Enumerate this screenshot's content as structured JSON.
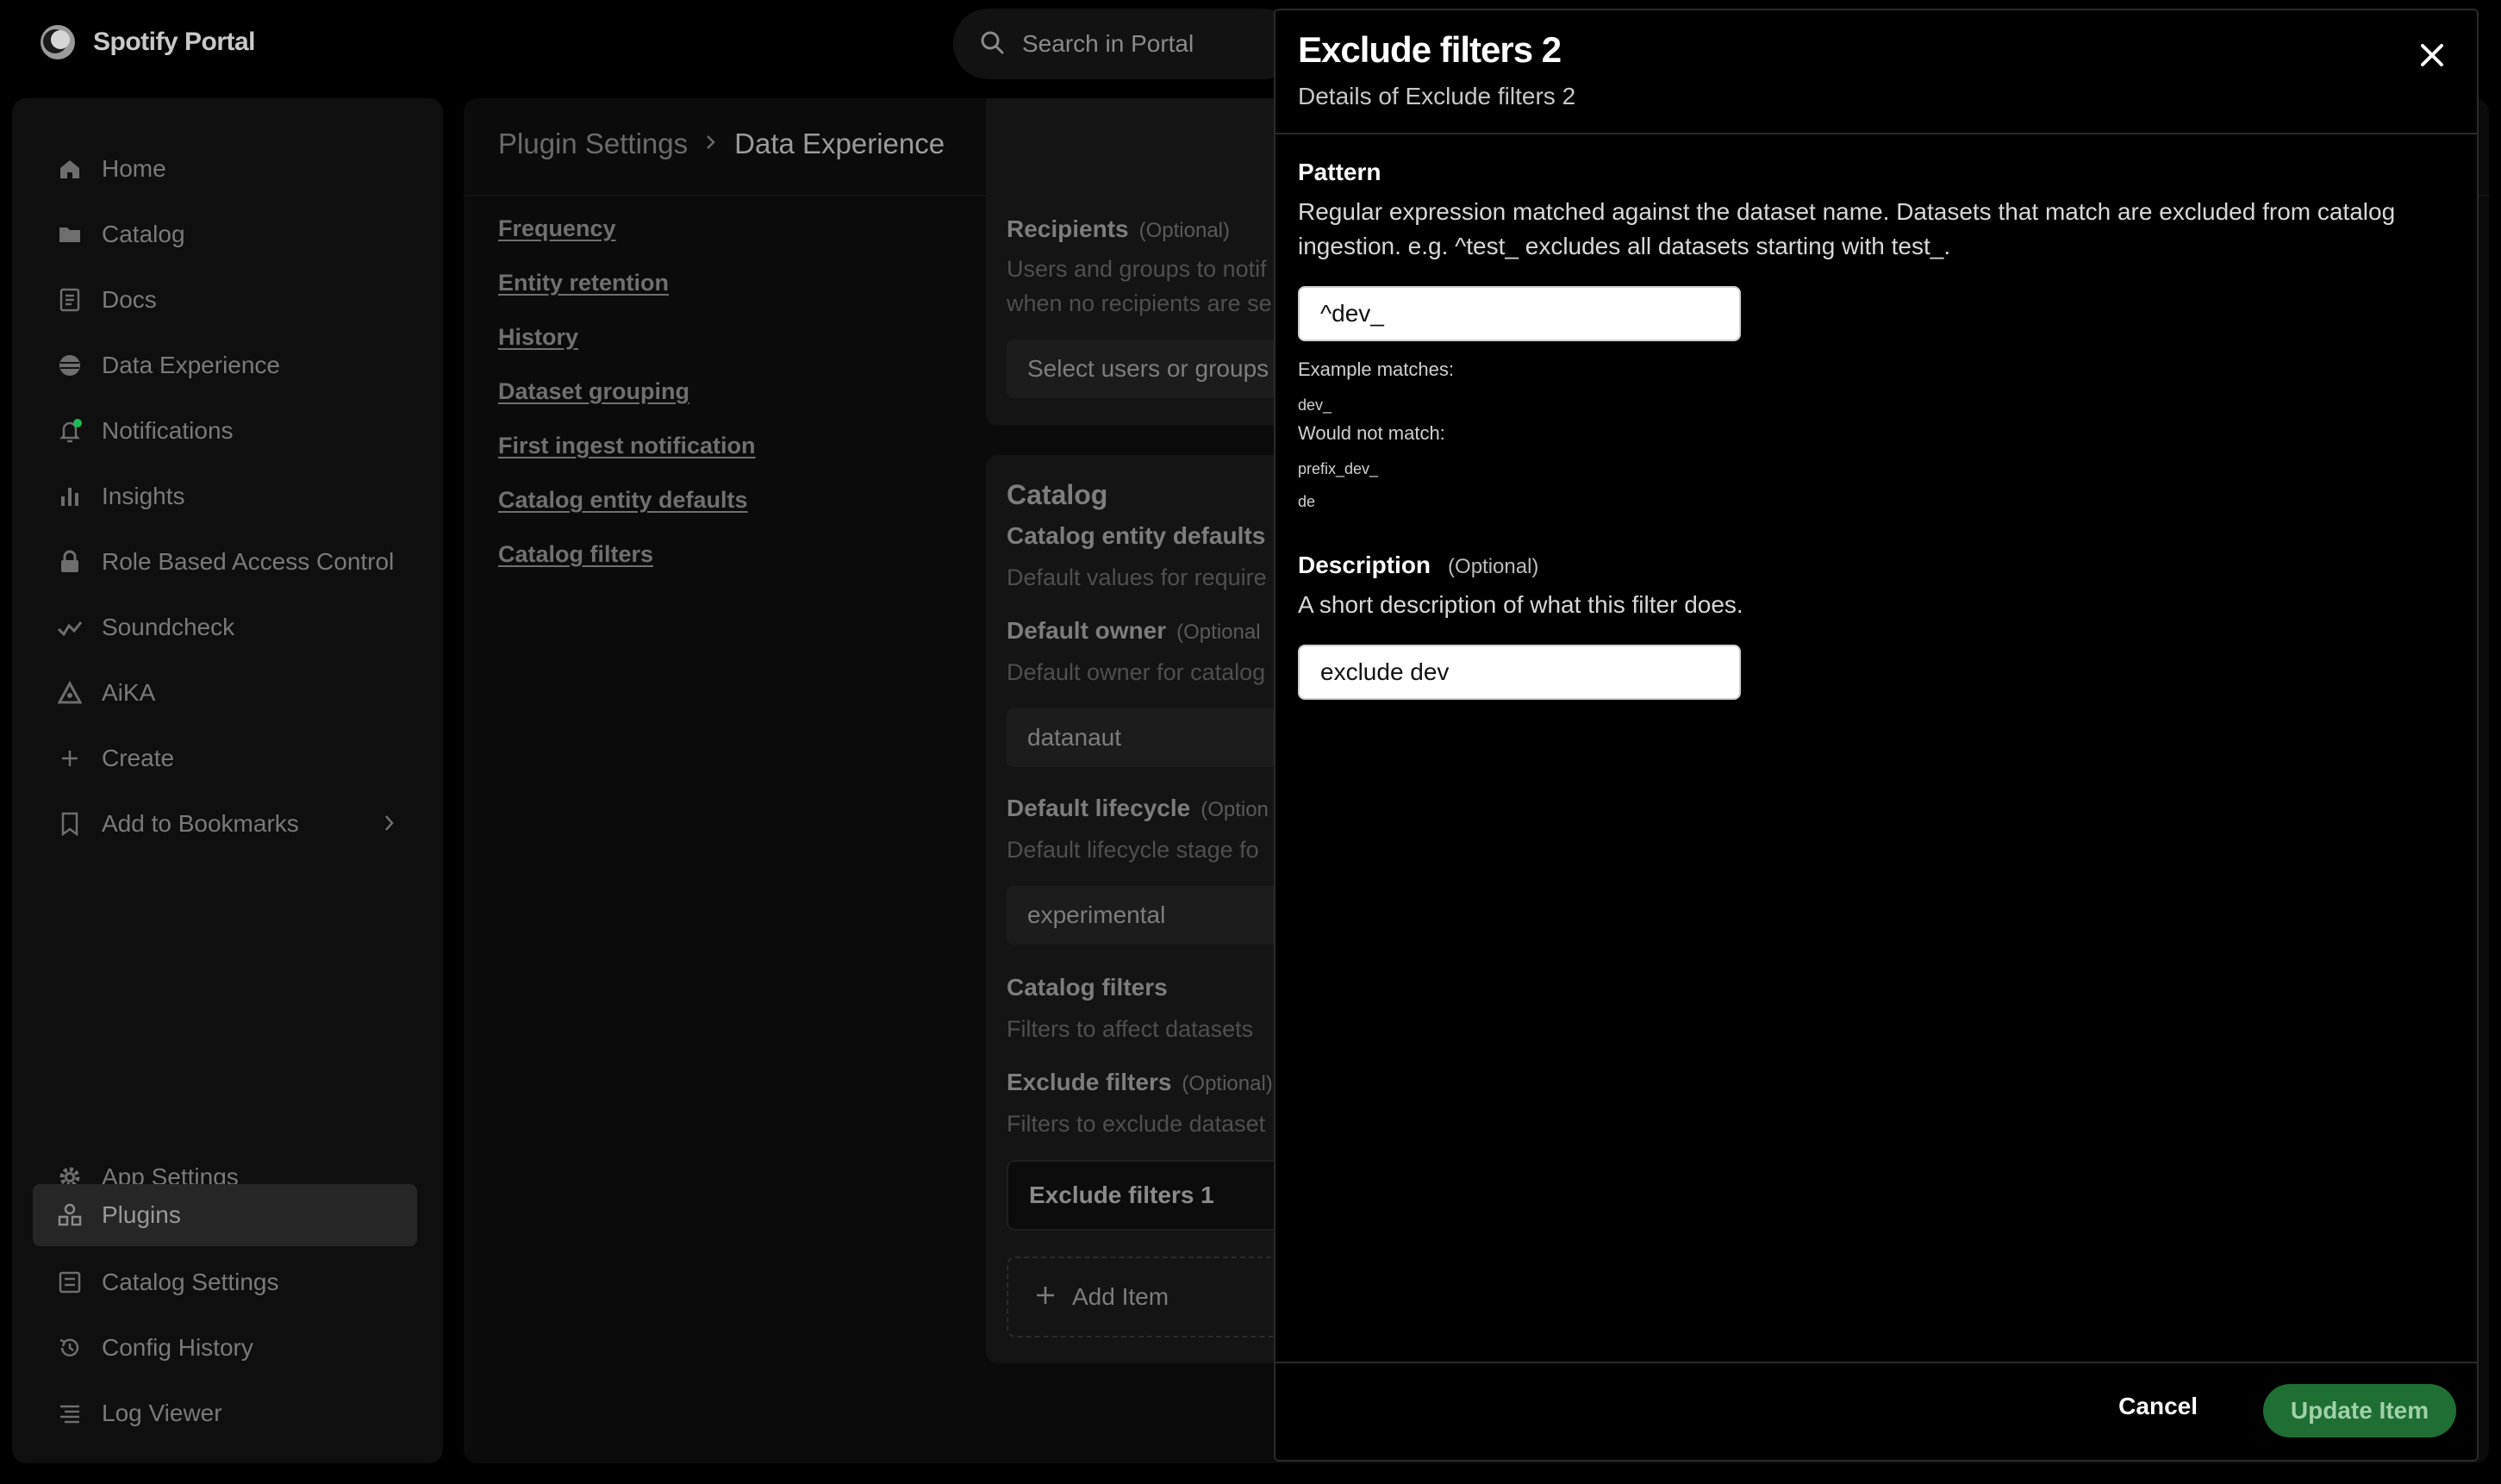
{
  "app": {
    "name": "Spotify Portal"
  },
  "search": {
    "placeholder": "Search in Portal"
  },
  "sidebar": {
    "items": [
      {
        "label": "Home",
        "icon": "home-icon"
      },
      {
        "label": "Catalog",
        "icon": "folder-icon"
      },
      {
        "label": "Docs",
        "icon": "docs-icon"
      },
      {
        "label": "Data Experience",
        "icon": "database-icon"
      },
      {
        "label": "Notifications",
        "icon": "bell-icon"
      },
      {
        "label": "Insights",
        "icon": "bar-chart-icon"
      },
      {
        "label": "Role Based Access Control",
        "icon": "lock-icon"
      },
      {
        "label": "Soundcheck",
        "icon": "check-wave-icon"
      },
      {
        "label": "AiKA",
        "icon": "triangle-icon"
      },
      {
        "label": "Create",
        "icon": "plus-icon"
      },
      {
        "label": "Add to Bookmarks",
        "icon": "bookmark-icon"
      }
    ],
    "bottom_items": [
      {
        "label": "App Settings",
        "icon": "gear-icon"
      },
      {
        "label": "Plugins",
        "icon": "plugins-icon"
      },
      {
        "label": "Catalog Settings",
        "icon": "catalog-settings-icon"
      },
      {
        "label": "Config History",
        "icon": "history-icon"
      },
      {
        "label": "Log Viewer",
        "icon": "log-icon"
      }
    ],
    "active_item": "Plugins"
  },
  "breadcrumb": {
    "parent": "Plugin Settings",
    "current": "Data Experience"
  },
  "toc": [
    "Frequency",
    "Entity retention",
    "History",
    "Dataset grouping",
    "First ingest notification",
    "Catalog entity defaults",
    "Catalog filters"
  ],
  "recipients": {
    "title": "Recipients",
    "optional": "(Optional)",
    "desc_line1": "Users and groups to notif",
    "desc_line2": "when no recipients are se",
    "select_placeholder": "Select users or groups"
  },
  "catalog_card": {
    "title": "Catalog",
    "entity_defaults_title": "Catalog entity defaults",
    "entity_defaults_desc": "Default values for require",
    "default_owner_label": "Default owner",
    "default_owner_optional": "(Optional",
    "default_owner_desc": "Default owner for catalog",
    "default_owner_value": "datanaut",
    "default_lifecycle_label": "Default lifecycle",
    "default_lifecycle_optional": "(Option",
    "default_lifecycle_desc": "Default lifecycle stage fo",
    "default_lifecycle_value": "experimental",
    "filters_title": "Catalog filters",
    "filters_desc": "Filters to affect datasets",
    "exclude_label": "Exclude filters",
    "exclude_optional": "(Optional)",
    "exclude_desc": "Filters to exclude dataset",
    "exclude_item_1": "Exclude filters 1",
    "add_item": "Add Item"
  },
  "panel": {
    "title": "Exclude filters 2",
    "subtitle": "Details of Exclude filters 2",
    "pattern_label": "Pattern",
    "pattern_desc": "Regular expression matched against the dataset name. Datasets that match are excluded from catalog ingestion. e.g. ^test_ excludes all datasets starting with test_.",
    "pattern_value": "^dev_",
    "example_matches_label": "Example matches:",
    "example_matches": [
      "dev_"
    ],
    "would_not_match_label": "Would not match:",
    "would_not_match": [
      "prefix_dev_",
      "de"
    ],
    "description_label": "Description",
    "description_optional": "(Optional)",
    "description_desc": "A short description of what this filter does.",
    "description_value": "exclude dev",
    "cancel": "Cancel",
    "update": "Update Item"
  },
  "colors": {
    "accent": "#1f6e34",
    "notification_dot": "#1db954"
  }
}
